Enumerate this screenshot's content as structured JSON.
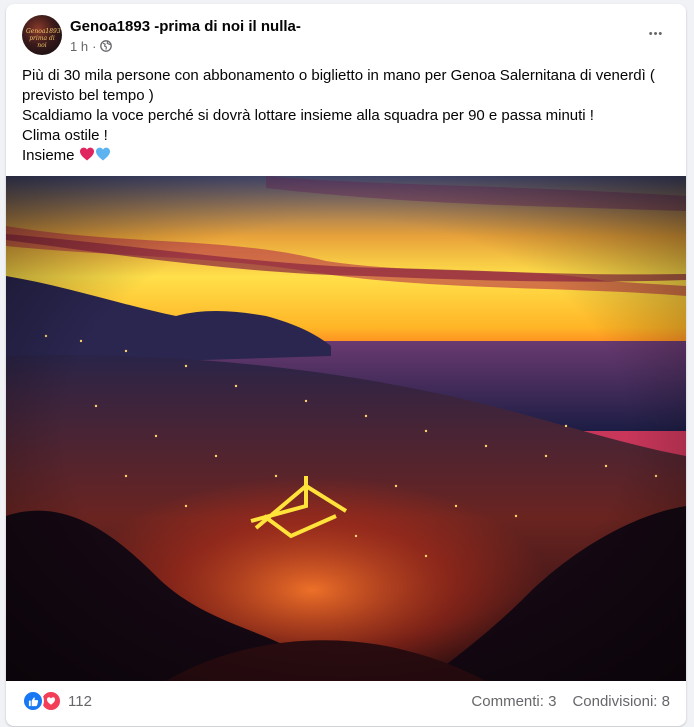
{
  "post": {
    "page_name": "Genoa1893 -prima di noi il nulla-",
    "time": "1 h",
    "separator": "·",
    "more_label": "•••",
    "avatar_text": "Genoa1893 prima di noi",
    "text_lines": [
      "Più di 30 mila persone con abbonamento o biglietto in mano per Genoa Salernitana di venerdì (",
      "previsto bel tempo )",
      "Scaldiamo la voce perché si dovrà lottare insieme alla squadra per 90 e passa minuti !",
      "Clima ostile !",
      "Insieme"
    ],
    "emoji": [
      "red-heart",
      "blue-heart"
    ]
  },
  "footer": {
    "reaction_count": "112",
    "comments": "Commenti: 3",
    "shares": "Condivisioni: 8"
  },
  "colors": {
    "accent": "#1877f2",
    "love": "#f33e58",
    "secondary_text": "#65676b"
  },
  "icons": [
    "globe-icon",
    "more-icon",
    "like-reaction-icon",
    "love-reaction-icon"
  ]
}
